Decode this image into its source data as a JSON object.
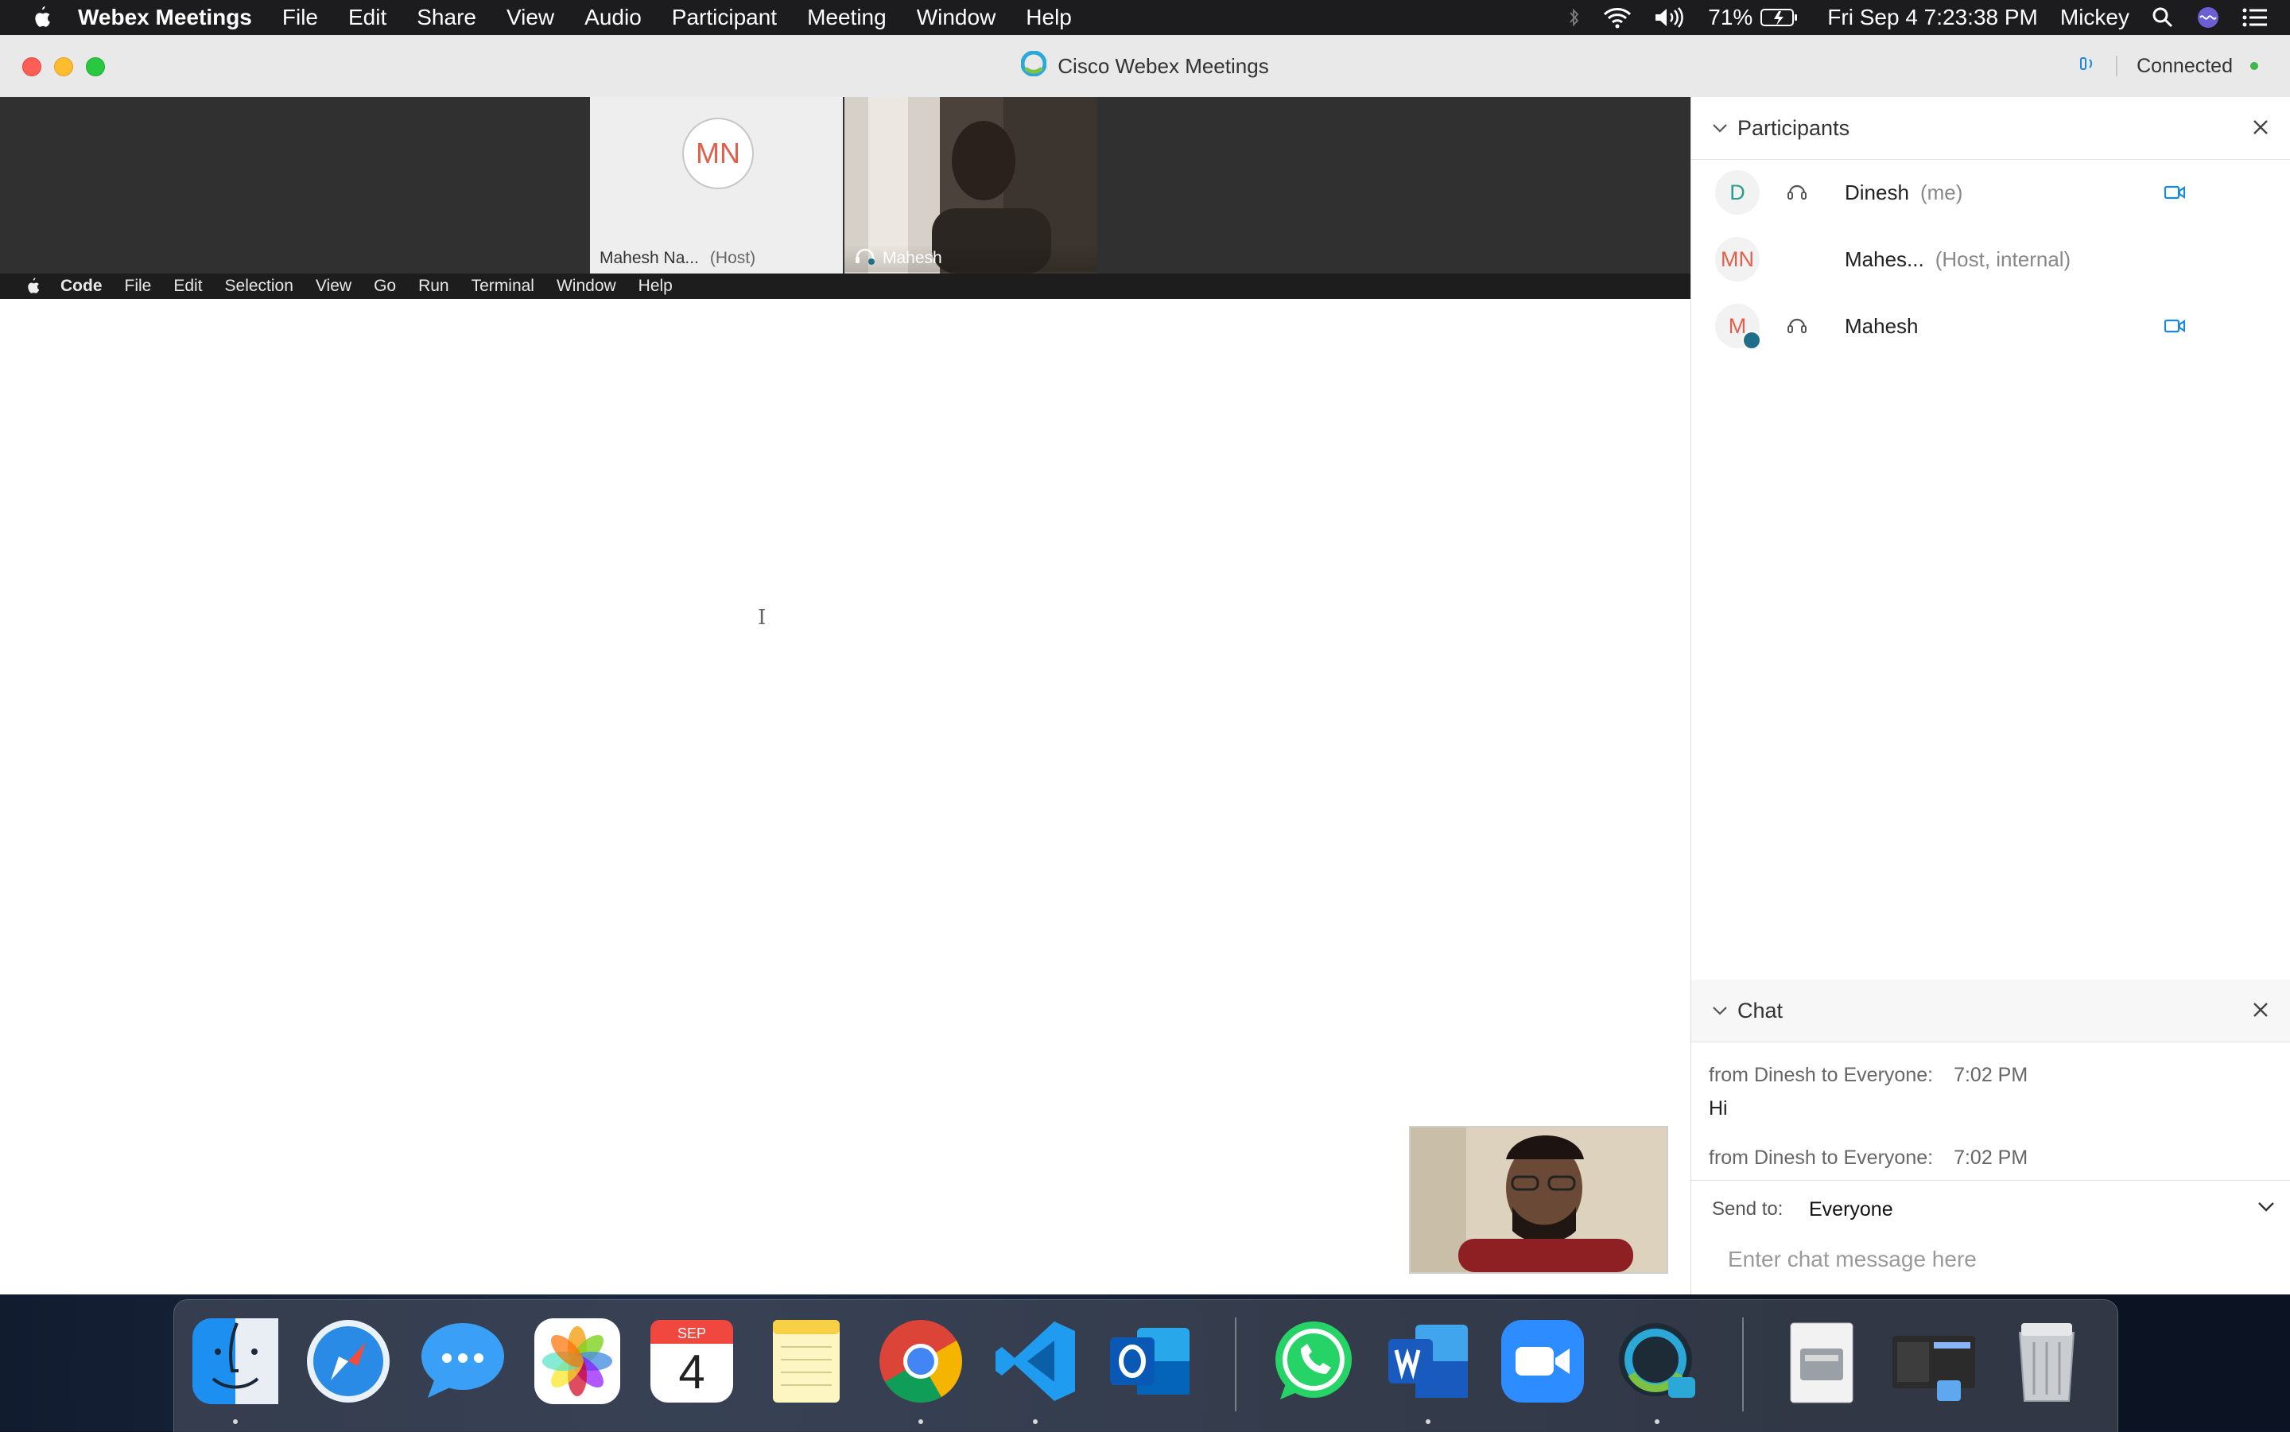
{
  "menubar": {
    "app": "Webex Meetings",
    "items": [
      "File",
      "Edit",
      "Share",
      "View",
      "Audio",
      "Participant",
      "Meeting",
      "Window",
      "Help"
    ],
    "battery": "71%",
    "datetime": "Fri Sep 4  7:23:38 PM",
    "user": "Mickey"
  },
  "window": {
    "title": "Cisco Webex Meetings",
    "status": "Connected"
  },
  "filmstrip": {
    "tile1": {
      "initials": "MN",
      "name": "Mahesh Na...",
      "role": "(Host)"
    },
    "tile2": {
      "name": "Mahesh"
    }
  },
  "shared_screen": {
    "app": "Code",
    "menu": [
      "File",
      "Edit",
      "Selection",
      "View",
      "Go",
      "Run",
      "Terminal",
      "Window",
      "Help"
    ]
  },
  "participants": {
    "title": "Participants",
    "list": [
      {
        "initials": "D",
        "name": "Dinesh",
        "tag": "(me)",
        "color": "#2a9d8f"
      },
      {
        "initials": "MN",
        "name": "Mahes...",
        "tag": "(Host, internal)",
        "color": "#e0604c"
      },
      {
        "initials": "M",
        "name": "Mahesh",
        "tag": "",
        "color": "#e0604c"
      }
    ]
  },
  "chat": {
    "title": "Chat",
    "messages": [
      {
        "from": "from Dinesh to Everyone:",
        "time": "7:02  PM",
        "text": "Hi"
      },
      {
        "from": "from Dinesh to Everyone:",
        "time": "7:02  PM",
        "text": ""
      }
    ],
    "send_to_label": "Send to:",
    "send_to_value": "Everyone",
    "input_placeholder": "Enter chat message here"
  },
  "calendar_icon": {
    "month": "SEP",
    "day": "4"
  },
  "colors": {
    "accent": "#1a8ad8",
    "connected": "#3fb54a",
    "avatar_text": "#e0604c"
  }
}
